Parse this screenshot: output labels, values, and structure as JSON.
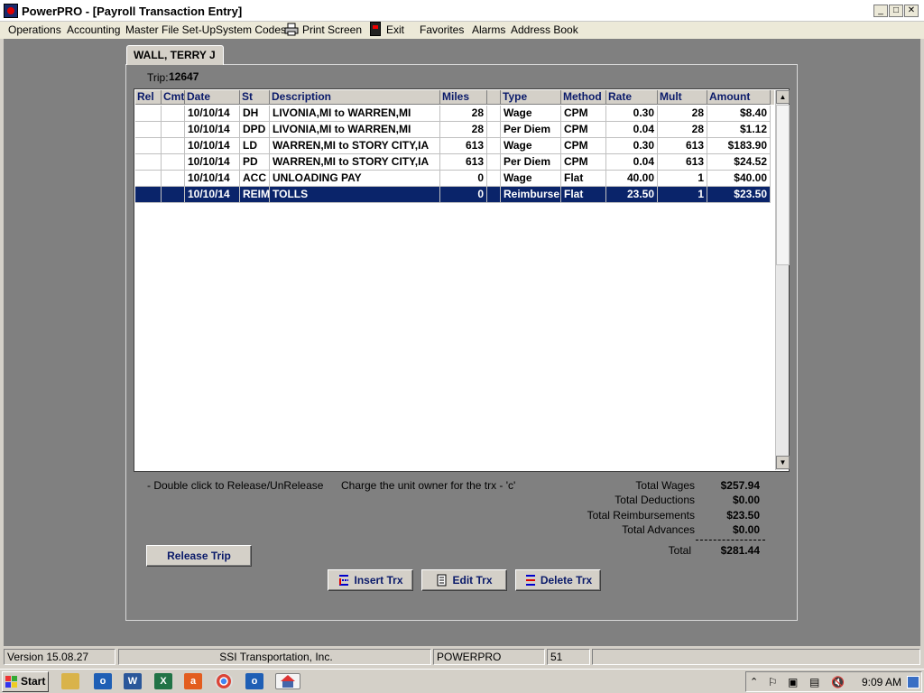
{
  "window": {
    "title": "PowerPRO - [Payroll Transaction Entry]"
  },
  "menu": [
    {
      "label": "Operations"
    },
    {
      "label": "Accounting"
    },
    {
      "label": "Master File Set-Up"
    },
    {
      "label": "System Codes"
    },
    {
      "label": "Print Screen"
    },
    {
      "label": "Exit"
    },
    {
      "label": "Favorites"
    },
    {
      "label": "Alarms"
    },
    {
      "label": "Address Book"
    }
  ],
  "driver_tab": {
    "label": "WALL, TERRY J"
  },
  "trip": {
    "label": "Trip:",
    "value": "12647"
  },
  "grid": {
    "columns": [
      "Rel",
      "Cmt",
      "Date",
      "St",
      "Description",
      "Miles",
      "",
      "Type",
      "Method",
      "Rate",
      "Mult",
      "Amount"
    ],
    "rows": [
      {
        "rel": "",
        "cmt": "",
        "date": "10/10/14",
        "st": "DH",
        "description": "LIVONIA,MI to WARREN,MI",
        "miles": "28",
        "flag": "",
        "type": "Wage",
        "method": "CPM",
        "rate": "0.30",
        "mult": "28",
        "amount": "$8.40",
        "selected": false
      },
      {
        "rel": "",
        "cmt": "",
        "date": "10/10/14",
        "st": "DPD",
        "description": "LIVONIA,MI to WARREN,MI",
        "miles": "28",
        "flag": "",
        "type": "Per Diem",
        "method": "CPM",
        "rate": "0.04",
        "mult": "28",
        "amount": "$1.12",
        "selected": false
      },
      {
        "rel": "",
        "cmt": "",
        "date": "10/10/14",
        "st": "LD",
        "description": "WARREN,MI to STORY CITY,IA",
        "miles": "613",
        "flag": "",
        "type": "Wage",
        "method": "CPM",
        "rate": "0.30",
        "mult": "613",
        "amount": "$183.90",
        "selected": false
      },
      {
        "rel": "",
        "cmt": "",
        "date": "10/10/14",
        "st": "PD",
        "description": "WARREN,MI to STORY CITY,IA",
        "miles": "613",
        "flag": "",
        "type": "Per Diem",
        "method": "CPM",
        "rate": "0.04",
        "mult": "613",
        "amount": "$24.52",
        "selected": false
      },
      {
        "rel": "",
        "cmt": "",
        "date": "10/10/14",
        "st": "ACC",
        "description": "UNLOADING PAY",
        "miles": "0",
        "flag": "",
        "type": "Wage",
        "method": "Flat",
        "rate": "40.00",
        "mult": "1",
        "amount": "$40.00",
        "selected": false
      },
      {
        "rel": "",
        "cmt": "",
        "date": "10/10/14",
        "st": "REIM",
        "description": "TOLLS",
        "miles": "0",
        "flag": "",
        "type": "Reimburse",
        "method": "Flat",
        "rate": "23.50",
        "mult": "1",
        "amount": "$23.50",
        "selected": true
      }
    ]
  },
  "notes": {
    "release": "- Double click to Release/UnRelease",
    "charge": "Charge the unit owner for the trx - 'c'"
  },
  "totals": {
    "wages_label": "Total Wages",
    "wages": "$257.94",
    "deductions_label": "Total Deductions",
    "deductions": "$0.00",
    "reimbursements_label": "Total Reimbursements",
    "reimbursements": "$23.50",
    "advances_label": "Total Advances",
    "advances": "$0.00",
    "total_label": "Total",
    "total": "$281.44"
  },
  "buttons": {
    "release_trip": "Release Trip",
    "insert_trx": "Insert Trx",
    "edit_trx": "Edit Trx",
    "delete_trx": "Delete Trx"
  },
  "status": {
    "version": "Version 15.08.27",
    "company": "SSI Transportation, Inc.",
    "database": "POWERPRO",
    "session": "51"
  },
  "taskbar": {
    "start": "Start",
    "clock": "9:09 AM"
  },
  "colors": {
    "selection": "#0a246a",
    "mdi_background": "#808080",
    "header_text": "#0a1a6a"
  }
}
